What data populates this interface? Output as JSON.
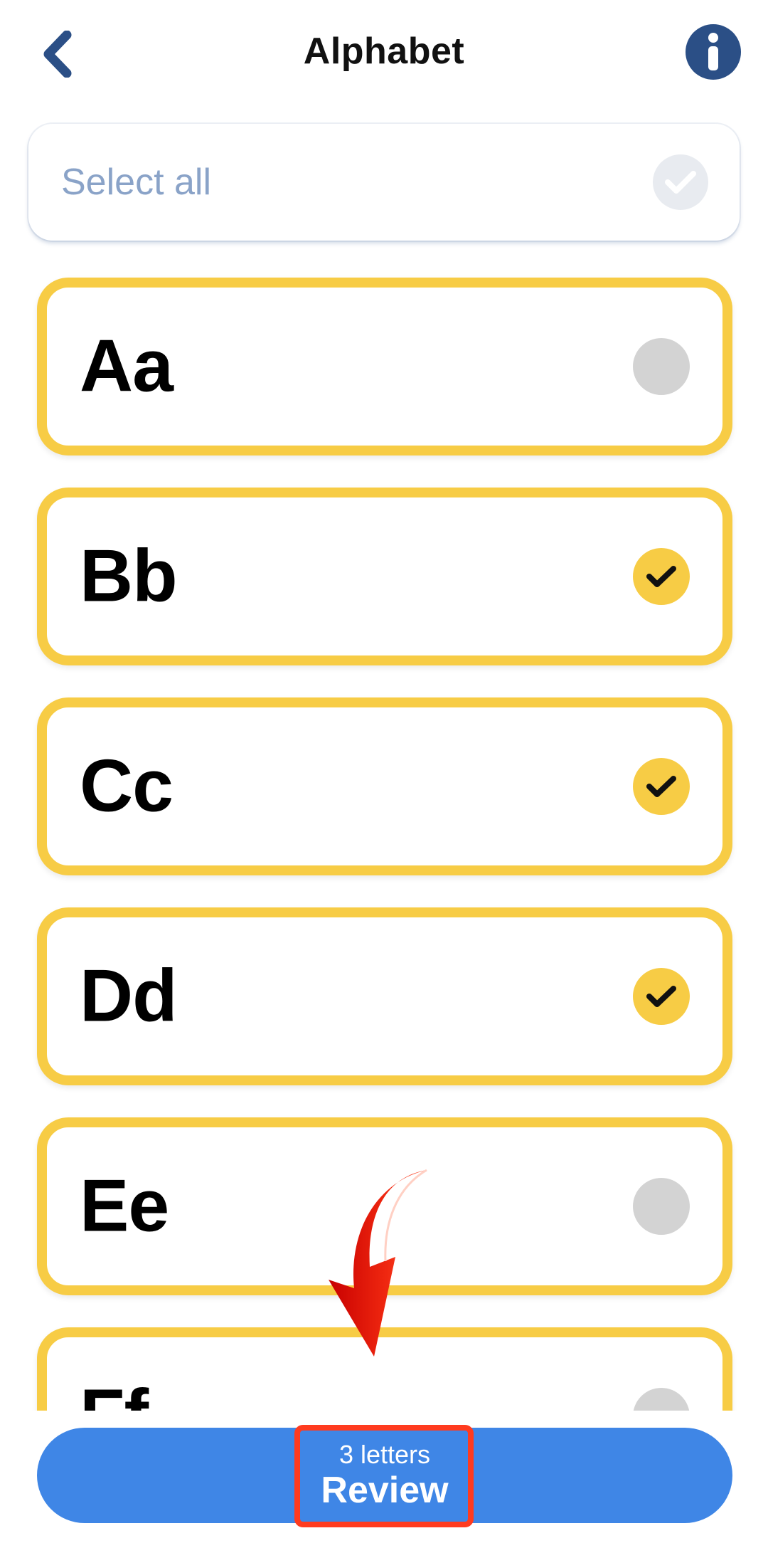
{
  "header": {
    "title": "Alphabet",
    "back_icon": "chevron-left-icon",
    "info_icon": "info-icon"
  },
  "select_all": {
    "label": "Select all",
    "checked": false
  },
  "letters": [
    {
      "label": "Aa",
      "selected": false
    },
    {
      "label": "Bb",
      "selected": true
    },
    {
      "label": "Cc",
      "selected": true
    },
    {
      "label": "Dd",
      "selected": true
    },
    {
      "label": "Ee",
      "selected": false
    },
    {
      "label": "Ff",
      "selected": false
    }
  ],
  "review_button": {
    "count_text": "3 letters",
    "label": "Review"
  },
  "colors": {
    "accent_yellow": "#f7cc45",
    "button_blue": "#3f86e6",
    "info_navy": "#2b4f86",
    "annotation_red": "#ff3b1f"
  }
}
